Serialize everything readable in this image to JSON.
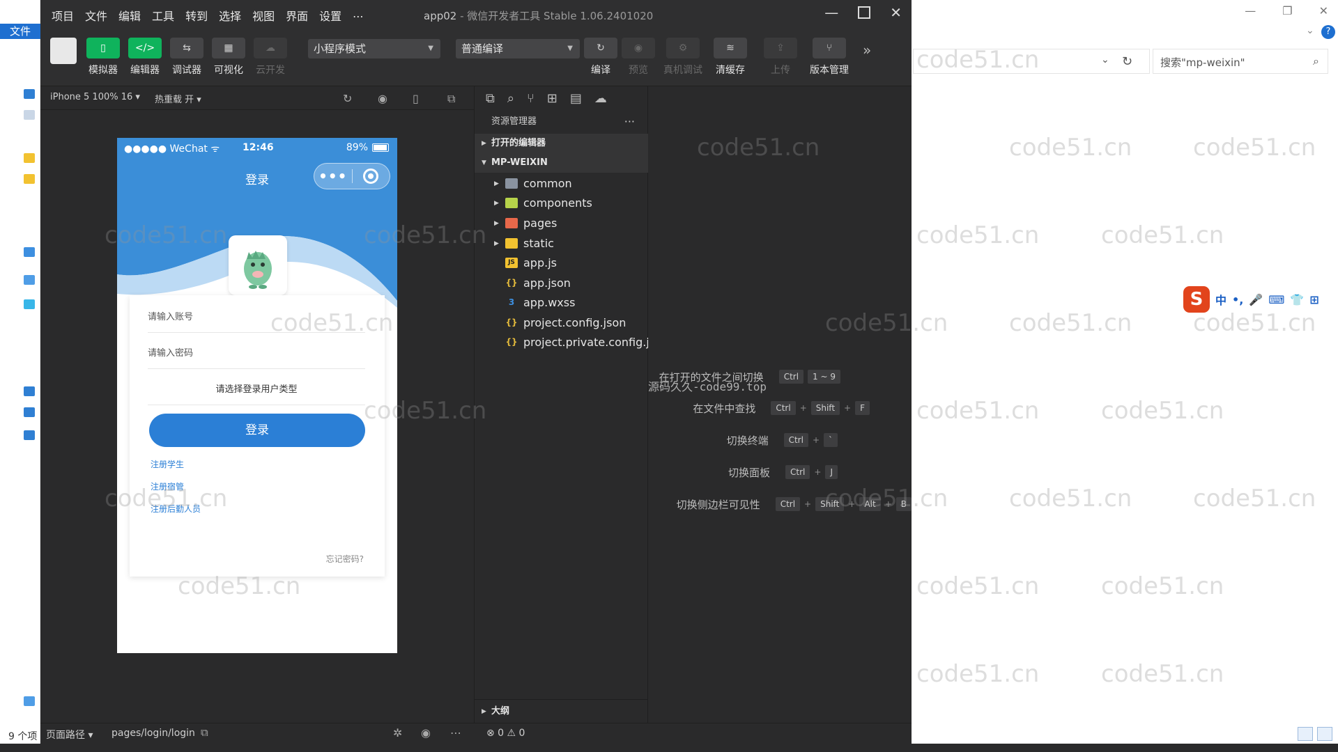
{
  "explorer": {
    "file_tab": "文件",
    "search_placeholder": "搜索\"mp-weixin\"",
    "item_count": "9 个项",
    "win_controls": [
      "—",
      "❐",
      "✕"
    ],
    "help": "?",
    "ime": {
      "logo": "S",
      "items": [
        "中",
        "•,",
        "🎤",
        "⌨",
        "👕",
        "⊞"
      ]
    }
  },
  "watermark": "code51.cn",
  "app": {
    "menu": [
      "项目",
      "文件",
      "编辑",
      "工具",
      "转到",
      "选择",
      "视图",
      "界面",
      "设置",
      "..."
    ],
    "title_app": "app02",
    "title_rest": " - 微信开发者工具 Stable 1.06.2401020",
    "window_controls": {
      "minimize": "—",
      "close": "✕"
    }
  },
  "toolbar": {
    "buttons": [
      {
        "label": "模拟器",
        "icon": "▯",
        "active": true
      },
      {
        "label": "编辑器",
        "icon": "</>",
        "active": true
      },
      {
        "label": "调试器",
        "icon": "⇆",
        "active": false
      },
      {
        "label": "可视化",
        "icon": "▦",
        "active": false
      },
      {
        "label": "云开发",
        "icon": "☁",
        "active": false,
        "disabled": true
      }
    ],
    "mode_select": "小程序模式",
    "compile_select": "普通编译",
    "actions": [
      {
        "label": "编译",
        "icon": "↻",
        "disabled": false
      },
      {
        "label": "预览",
        "icon": "◉",
        "disabled": true
      },
      {
        "label": "真机调试",
        "icon": "⚙",
        "disabled": true
      },
      {
        "label": "清缓存",
        "icon": "≋",
        "disabled": false
      },
      {
        "label": "上传",
        "icon": "⇪",
        "disabled": true
      },
      {
        "label": "版本管理",
        "icon": "⑂",
        "disabled": false
      }
    ],
    "more": "»"
  },
  "simulator": {
    "device": "iPhone 5 100% 16 ▾",
    "hot_reload": "热重载 开 ▾",
    "status": {
      "carrier": "●●●●● WeChat ᯤ",
      "time": "12:46",
      "battery": "89%"
    },
    "nav_title": "登录",
    "capsule_dots": "•••",
    "form": {
      "account_placeholder": "请输入账号",
      "password_placeholder": "请输入密码",
      "user_type": "请选择登录用户类型",
      "login_button": "登录",
      "links": [
        "注册学生",
        "注册宿管",
        "注册后勤人员"
      ],
      "forgot": "忘记密码?"
    }
  },
  "file_panel": {
    "header": "资源管理器",
    "menu": "···",
    "open_editors": "打开的编辑器",
    "project": "MP-WEIXIN",
    "items": [
      {
        "name": "common",
        "type": "folder",
        "color": "#8a93a0",
        "icon": ""
      },
      {
        "name": "components",
        "type": "folder",
        "color": "#b6d34a",
        "icon": ""
      },
      {
        "name": "pages",
        "type": "folder",
        "color": "#e8684a",
        "icon": ""
      },
      {
        "name": "static",
        "type": "folder",
        "color": "#f2c230",
        "icon": ""
      },
      {
        "name": "app.js",
        "type": "file",
        "color": "#f2c230",
        "icon": "JS"
      },
      {
        "name": "app.json",
        "type": "file",
        "color": "#e2b93b",
        "icon": "{}"
      },
      {
        "name": "app.wxss",
        "type": "file",
        "color": "#3d8fe0",
        "icon": "3"
      },
      {
        "name": "project.config.json",
        "type": "file",
        "color": "#e2b93b",
        "icon": "{}"
      },
      {
        "name": "project.private.config.js...",
        "type": "file",
        "color": "#e2b93b",
        "icon": "{}"
      }
    ],
    "outline": "大纲"
  },
  "editor": {
    "shortcuts": [
      {
        "label": "在打开的文件之间切换",
        "keys": [
          "Ctrl",
          "1 ~ 9"
        ]
      },
      {
        "label": "在文件中查找",
        "keys": [
          "Ctrl",
          "Shift",
          "F"
        ]
      },
      {
        "label": "切换终端",
        "keys": [
          "Ctrl",
          "`"
        ]
      },
      {
        "label": "切换面板",
        "keys": [
          "Ctrl",
          "J"
        ]
      },
      {
        "label": "切换侧边栏可见性",
        "keys": [
          "Ctrl",
          "Shift",
          "Alt",
          "B"
        ]
      }
    ],
    "overlay_text": "源码久久-code99.top"
  },
  "status_bar": {
    "path_label": "页面路径 ▾",
    "path": "pages/login/login",
    "errors": "⊗ 0 ⚠ 0"
  }
}
